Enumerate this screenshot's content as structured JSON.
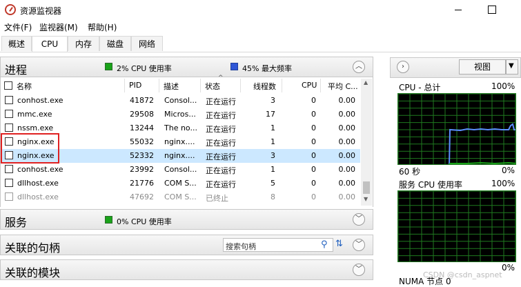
{
  "window": {
    "title": "资源监视器"
  },
  "menu": [
    "文件(F)",
    "监视器(M)",
    "帮助(H)"
  ],
  "tabs": [
    "概述",
    "CPU",
    "内存",
    "磁盘",
    "网络"
  ],
  "active_tab": "CPU",
  "processes": {
    "title": "进程",
    "cpu_usage": "2% CPU 使用率",
    "max_freq": "45% 最大频率",
    "columns": [
      "名称",
      "PID",
      "描述",
      "状态",
      "线程数",
      "CPU",
      "平均 C..."
    ],
    "rows": [
      {
        "name": "conhost.exe",
        "pid": "41872",
        "desc": "Consol...",
        "status": "正在运行",
        "threads": "3",
        "cpu": "0",
        "avg": "0.00"
      },
      {
        "name": "mmc.exe",
        "pid": "29508",
        "desc": "Micros...",
        "status": "正在运行",
        "threads": "17",
        "cpu": "0",
        "avg": "0.00"
      },
      {
        "name": "nssm.exe",
        "pid": "13244",
        "desc": "The no...",
        "status": "正在运行",
        "threads": "1",
        "cpu": "0",
        "avg": "0.00"
      },
      {
        "name": "nginx.exe",
        "pid": "55032",
        "desc": "nginx....",
        "status": "正在运行",
        "threads": "1",
        "cpu": "0",
        "avg": "0.00"
      },
      {
        "name": "nginx.exe",
        "pid": "52332",
        "desc": "nginx....",
        "status": "正在运行",
        "threads": "3",
        "cpu": "0",
        "avg": "0.00"
      },
      {
        "name": "conhost.exe",
        "pid": "23992",
        "desc": "Consol...",
        "status": "正在运行",
        "threads": "1",
        "cpu": "0",
        "avg": "0.00"
      },
      {
        "name": "dllhost.exe",
        "pid": "21776",
        "desc": "COM S...",
        "status": "正在运行",
        "threads": "5",
        "cpu": "0",
        "avg": "0.00"
      },
      {
        "name": "dllhost.exe",
        "pid": "47692",
        "desc": "COM S...",
        "status": "已终止",
        "threads": "8",
        "cpu": "0",
        "avg": "0.00"
      }
    ]
  },
  "services": {
    "title": "服务",
    "cpu_usage": "0% CPU 使用率"
  },
  "handles": {
    "title": "关联的句柄",
    "search_placeholder": "搜索句柄"
  },
  "modules": {
    "title": "关联的模块"
  },
  "right": {
    "view_label": "视图",
    "cpu_total": "CPU - 总计",
    "pct100": "100%",
    "sixty": "60 秒",
    "pct0": "0%",
    "service_cpu": "服务 CPU 使用率",
    "numa": "NUMA 节点 0"
  },
  "watermark": "CSDN @csdn_aspnet",
  "colors": {
    "graph_bg": "#000000",
    "grid": "#1f7a1f",
    "line_blue": "#5b8fff",
    "line_green": "#1aa31a",
    "highlight": "#e02020"
  }
}
